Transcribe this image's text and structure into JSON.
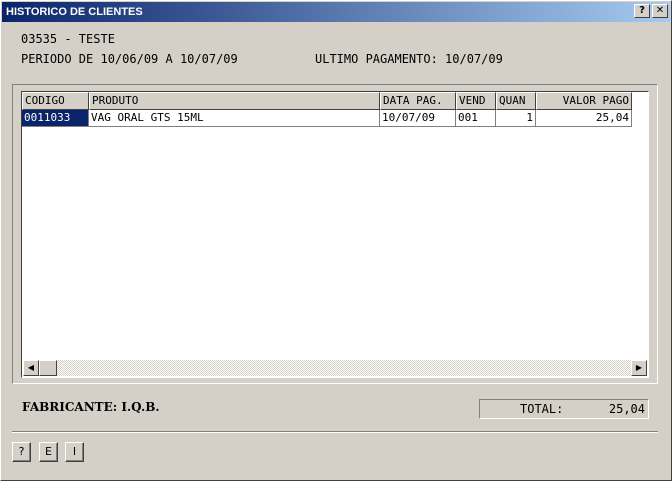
{
  "window": {
    "title": "HISTORICO DE CLIENTES",
    "help_label": "?",
    "close_label": "✕"
  },
  "info": {
    "client": "03535 - TESTE",
    "period": "PERIODO DE 10/06/09 A 10/07/09",
    "last_payment": "ULTIMO PAGAMENTO: 10/07/09"
  },
  "table": {
    "columns": [
      "CODIGO",
      "PRODUTO",
      "DATA PAG.",
      "VEND",
      "QUAN",
      "VALOR PAGO"
    ],
    "rows": [
      {
        "codigo": "0011033",
        "produto": "VAG ORAL GTS 15ML",
        "data": "10/07/09",
        "vend": "001",
        "quan": "1",
        "valor": "25,04"
      }
    ]
  },
  "scrollbar": {
    "left_arrow": "◀",
    "right_arrow": "▶"
  },
  "footer": {
    "fabricante": "FABRICANTE: I.Q.B.",
    "total_label": "TOTAL:",
    "total_value": "25,04"
  },
  "buttons": {
    "help": "?",
    "e": "E",
    "i": "I"
  }
}
